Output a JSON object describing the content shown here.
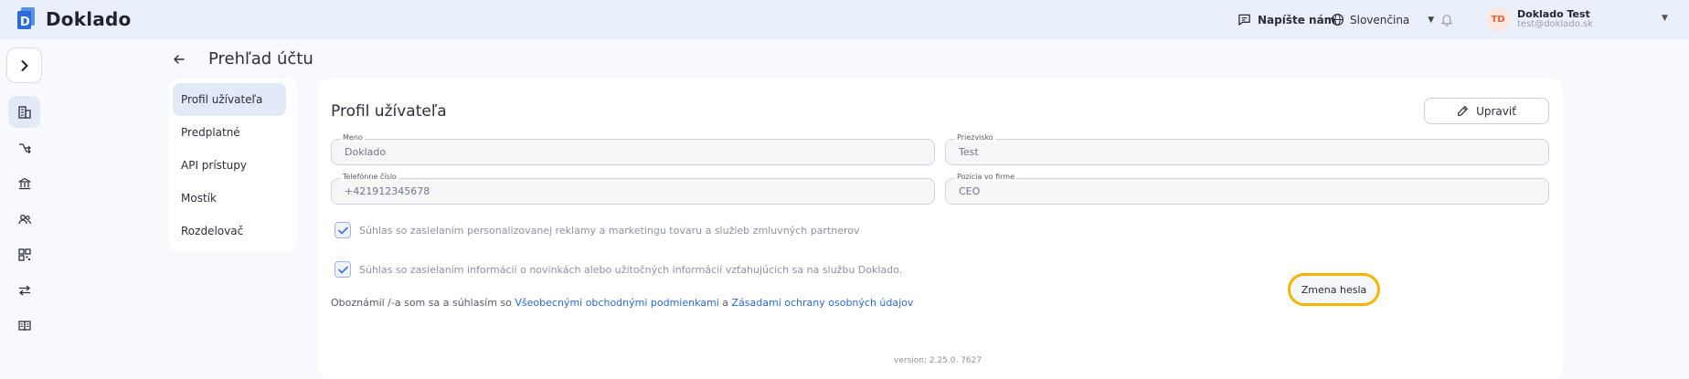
{
  "header": {
    "app_name": "Doklado",
    "contact_label": "Napíšte nám",
    "language": "Slovenčina",
    "user": {
      "initials": "TD",
      "name": "Doklado Test",
      "email": "test@doklado.sk"
    }
  },
  "rail": {
    "items": [
      "building-icon",
      "workflow-icon",
      "bank-icon",
      "users-icon",
      "qr-code-icon",
      "transfer-icon",
      "book-icon"
    ]
  },
  "page": {
    "title": "Prehľad účtu"
  },
  "subnav": {
    "items": [
      {
        "label": "Profil užívateľa",
        "active": true
      },
      {
        "label": "Predplatné",
        "active": false
      },
      {
        "label": "API prístupy",
        "active": false
      },
      {
        "label": "Mostík",
        "active": false
      },
      {
        "label": "Rozdelovač",
        "active": false
      }
    ]
  },
  "profile": {
    "title": "Profil užívateľa",
    "edit_label": "Upraviť",
    "fields": {
      "first_name": {
        "label": "Meno",
        "value": "Doklado"
      },
      "last_name": {
        "label": "Priezvisko",
        "value": "Test"
      },
      "phone": {
        "label": "Telefónne číslo",
        "value": "+421912345678"
      },
      "position": {
        "label": "Pozícia vo firme",
        "value": "CEO"
      }
    },
    "consents": [
      {
        "label": "Súhlas so zasielaním personalizovanej reklamy a marketingu tovaru a služieb zmluvných partnerov",
        "checked": true
      },
      {
        "label": "Súhlas so zasielaním informácií o novinkách alebo užitočných informácií vzťahujúcich sa na službu Doklado.",
        "checked": true
      }
    ],
    "terms": {
      "prefix": "Oboznámil /-a som sa a súhlasím so ",
      "terms_link": "Všeobecnými obchodnými podmienkami",
      "conjunction": " a ",
      "privacy_link": "Zásadami ochrany osobných údajov"
    },
    "change_password_label": "Zmena hesla",
    "version": "version: 2.25.0. 7627"
  },
  "colors": {
    "accent": "#2a6ad9",
    "highlight": "#f5b400",
    "header_bg": "#eaf0fb"
  }
}
